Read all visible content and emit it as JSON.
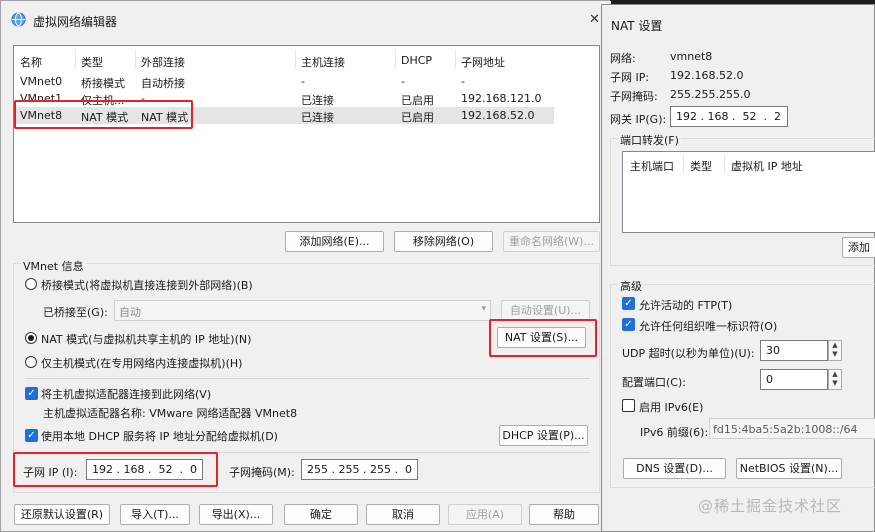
{
  "main": {
    "title": "虚拟网络编辑器",
    "close_glyph": "✕",
    "columns": [
      "名称",
      "类型",
      "外部连接",
      "主机连接",
      "DHCP",
      "子网地址"
    ],
    "rows": [
      [
        "VMnet0",
        "桥接模式",
        "自动桥接",
        "-",
        "-",
        "-"
      ],
      [
        "VMnet1",
        "仅主机...",
        "-",
        "已连接",
        "已启用",
        "192.168.121.0"
      ],
      [
        "VMnet8",
        "NAT 模式",
        "NAT 模式",
        "已连接",
        "已启用",
        "192.168.52.0"
      ]
    ],
    "add_network": "添加网络(E)...",
    "remove_network": "移除网络(O)",
    "rename_network": "重命名网络(W)...",
    "vmnet_info": "VMnet 信息",
    "bridge_mode": "桥接模式(将虚拟机直接连接到外部网络)(B)",
    "bridged_to_label": "已桥接至(G):",
    "bridged_to_value": "自动",
    "auto_settings": "自动设置(U)...",
    "nat_mode": "NAT 模式(与虚拟机共享主机的 IP 地址)(N)",
    "nat_settings": "NAT 设置(S)...",
    "host_only_mode": "仅主机模式(在专用网络内连接虚拟机)(H)",
    "connect_adapter": "将主机虚拟适配器连接到此网络(V)",
    "adapter_name": "主机虚拟适配器名称: VMware 网络适配器 VMnet8",
    "use_dhcp": "使用本地 DHCP 服务将 IP 地址分配给虚拟机(D)",
    "dhcp_settings": "DHCP 设置(P)...",
    "subnet_ip_label": "子网 IP (I):",
    "subnet_ip": [
      "192",
      "168",
      "52",
      "0"
    ],
    "subnet_mask_label": "子网掩码(M):",
    "subnet_mask": [
      "255",
      "255",
      "255",
      "0"
    ],
    "restore_defaults": "还原默认设置(R)",
    "import": "导入(T)...",
    "export": "导出(X)...",
    "ok": "确定",
    "cancel": "取消",
    "apply": "应用(A)",
    "help": "帮助"
  },
  "nat": {
    "title": "NAT 设置",
    "network_label": "网络:",
    "network_value": "vmnet8",
    "subnet_ip_label": "子网 IP:",
    "subnet_ip_value": "192.168.52.0",
    "subnet_mask_label": "子网掩码:",
    "subnet_mask_value": "255.255.255.0",
    "gateway_label": "网关 IP(G):",
    "gateway": [
      "192",
      "168",
      "52",
      "2"
    ],
    "port_forward_label": "端口转发(F)",
    "pf_columns": [
      "主机端口",
      "类型",
      "虚拟机 IP 地址"
    ],
    "add_button": "添加",
    "advanced_label": "高级",
    "allow_ftp": "允许活动的 FTP(T)",
    "allow_oui": "允许任何组织唯一标识符(O)",
    "udp_timeout_label": "UDP 超时(以秒为单位)(U):",
    "udp_timeout_value": "30",
    "config_port_label": "配置端口(C):",
    "config_port_value": "0",
    "enable_ipv6": "启用 IPv6(E)",
    "ipv6_prefix_label": "IPv6 前缀(6):",
    "ipv6_prefix_value": "fd15:4ba5:5a2b:1008::/64",
    "dns_settings": "DNS 设置(D)...",
    "netbios_settings": "NetBIOS 设置(N)..."
  },
  "watermark": "@稀土掘金技术社区",
  "colors": {
    "highlight": "#e1232b",
    "selection": "#e5e5e5",
    "accent": "#1f6fd6"
  }
}
